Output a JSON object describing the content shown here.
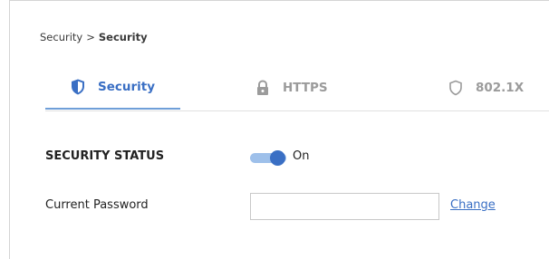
{
  "breadcrumb": {
    "parent": "Security",
    "separator": ">",
    "current": "Security"
  },
  "tabs": [
    {
      "label": "Security",
      "icon": "shield-filled-icon",
      "active": true
    },
    {
      "label": "HTTPS",
      "icon": "lock-icon",
      "active": false
    },
    {
      "label": "802.1X",
      "icon": "shield-outline-icon",
      "active": false
    }
  ],
  "security_status": {
    "label": "SECURITY STATUS",
    "toggle_state": "On",
    "enabled": true
  },
  "current_password": {
    "label": "Current Password",
    "value": "",
    "placeholder": "",
    "action_label": "Change"
  },
  "colors": {
    "accent": "#3a6fc4",
    "accent_light": "#9ec0ea",
    "inactive_tab": "#9b9b9b",
    "text": "#222222"
  }
}
